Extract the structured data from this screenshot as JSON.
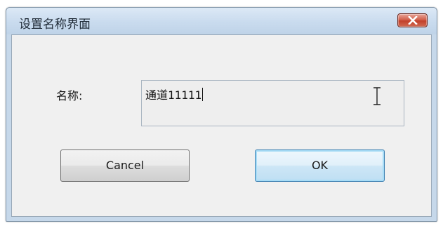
{
  "window": {
    "title": "设置名称界面",
    "close_icon": "close-icon"
  },
  "form": {
    "name_label": "名称:",
    "name_value": "通道11111",
    "cursor_icon": "text-cursor-ibeam-icon"
  },
  "buttons": {
    "cancel_label": "Cancel",
    "ok_label": "OK"
  },
  "colors": {
    "title_bar": "#c9dbee",
    "close_button": "#c2402a",
    "client_background": "#f0f0f0",
    "default_button_border": "#3c7fb1"
  }
}
